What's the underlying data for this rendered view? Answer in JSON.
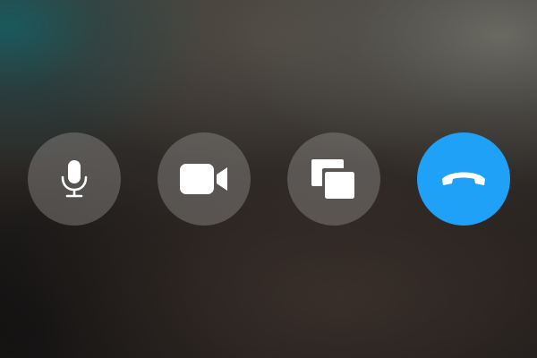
{
  "call_controls": {
    "buttons": [
      {
        "id": "mute",
        "icon": "microphone-icon"
      },
      {
        "id": "video",
        "icon": "video-camera-icon"
      },
      {
        "id": "share",
        "icon": "share-screen-icon"
      },
      {
        "id": "hangup",
        "icon": "end-call-icon"
      }
    ]
  },
  "colors": {
    "end_call": "#1ea1f6",
    "control_background": "rgba(150,148,146,0.42)",
    "icon": "#ffffff"
  }
}
